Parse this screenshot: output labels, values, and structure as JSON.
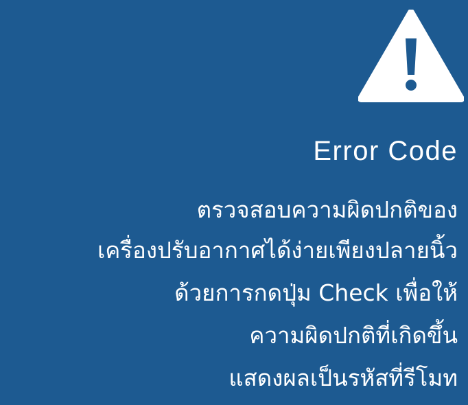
{
  "colors": {
    "background": "#1d5a91",
    "text": "#ffffff",
    "icon_fill": "#ffffff",
    "icon_mark": "#1d5a91"
  },
  "icon": "warning-triangle-icon",
  "title": "Error Code",
  "description_lines": [
    "ตรวจสอบความผิดปกติของ",
    "เครื่องปรับอากาศได้ง่ายเพียงปลายนิ้ว",
    "ด้วยการกดปุ่ม Check เพื่อให้",
    "ความผิดปกติที่เกิดขึ้น",
    "แสดงผลเป็นรหัสที่รีโมท"
  ]
}
